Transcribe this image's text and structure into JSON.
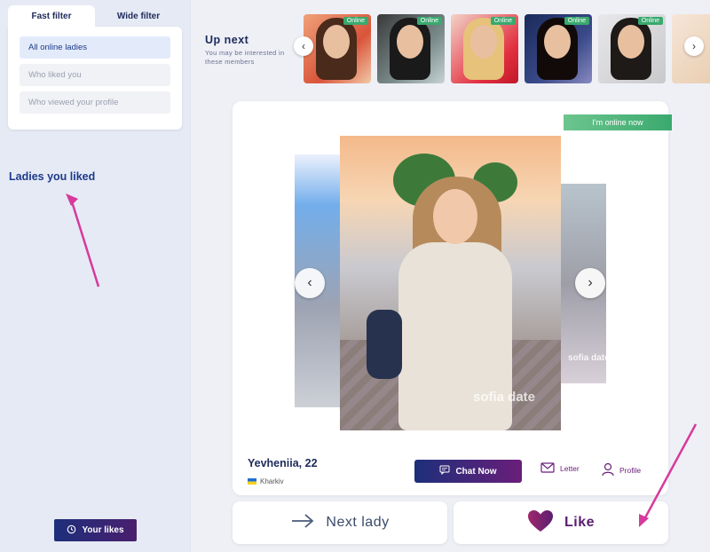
{
  "sidebar": {
    "tabs": [
      {
        "label": "Fast filter",
        "active": true
      },
      {
        "label": "Wide filter",
        "active": false
      }
    ],
    "filters": [
      {
        "label": "All online ladies",
        "selected": true
      },
      {
        "label": "Who liked you",
        "selected": false
      },
      {
        "label": "Who viewed your profile",
        "selected": false
      }
    ],
    "liked_heading": "Ladies you liked",
    "your_likes_label": "Your likes"
  },
  "upnext": {
    "title": "Up next",
    "subtitle": "You may be interested in these members",
    "members": [
      {
        "badge": "Online"
      },
      {
        "badge": "Online"
      },
      {
        "badge": "Online"
      },
      {
        "badge": "Online"
      },
      {
        "badge": "Online"
      },
      {
        "badge": ""
      }
    ]
  },
  "profile": {
    "online_status": "I'm online now",
    "name_age": "Yevheniia, 22",
    "city": "Kharkiv",
    "watermark": "sofia date",
    "side_watermark": "sofia date",
    "chat_label": "Chat Now",
    "letter_label": "Letter",
    "profile_label": "Profile"
  },
  "actions": {
    "next_label": "Next lady",
    "like_label": "Like"
  },
  "colors": {
    "brand_gradient_start": "#1d2f7a",
    "brand_gradient_end": "#6a1e7a",
    "online_green": "#3aa96e",
    "annotation_arrow": "#d63a9c"
  }
}
